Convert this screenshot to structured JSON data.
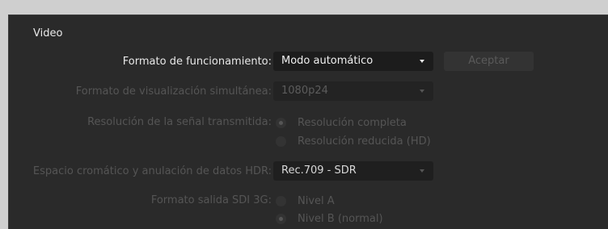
{
  "section": {
    "title": "Video"
  },
  "operating_format": {
    "label": "Formato de funcionamiento:",
    "value": "Modo automático",
    "button": "Aceptar"
  },
  "simultaneous_format": {
    "label": "Formato de visualización simultánea:",
    "value": "1080p24"
  },
  "signal_resolution": {
    "label": "Resolución de la señal transmitida:",
    "options": [
      "Resolución completa",
      "Resolución reducida (HD)"
    ],
    "selected": "Resolución completa"
  },
  "hdr_color_space": {
    "label": "Espacio cromático y anulación de datos HDR:",
    "value": "Rec.709 - SDR"
  },
  "sdi_output": {
    "label": "Formato salida SDI 3G:",
    "options": [
      "Nivel A",
      "Nivel B (normal)"
    ],
    "selected": "Nivel B (normal)"
  }
}
